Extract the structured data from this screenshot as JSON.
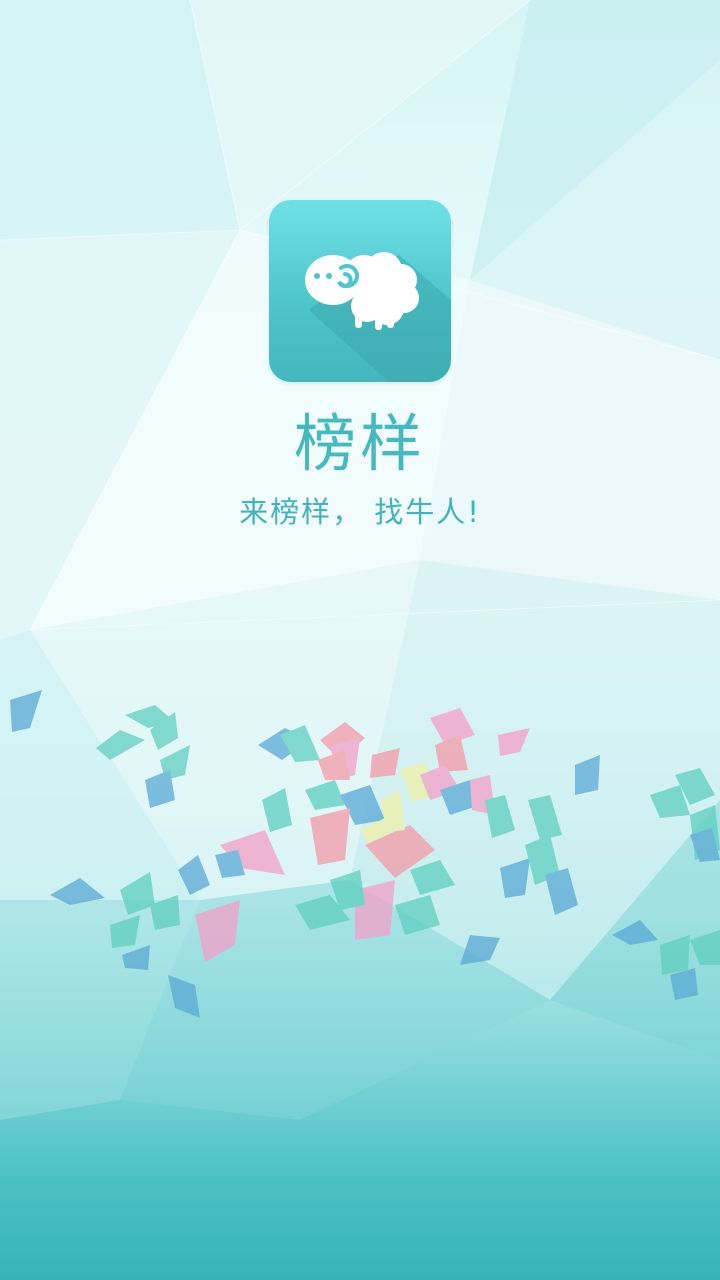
{
  "app": {
    "name": "榜样",
    "slogan": "来榜样， 找牛人!",
    "icon": "sheep-icon"
  },
  "colors": {
    "accent": "#45b9c0",
    "icon_bg_top": "#6fe1e6",
    "icon_bg_bottom": "#45b6bd",
    "confetti_pink": "#f4a0c8",
    "confetti_teal": "#5fcfc0",
    "confetti_blue": "#5aa9d6",
    "confetti_yellow": "#f0f0a8",
    "confetti_salmon": "#f49aa6"
  }
}
